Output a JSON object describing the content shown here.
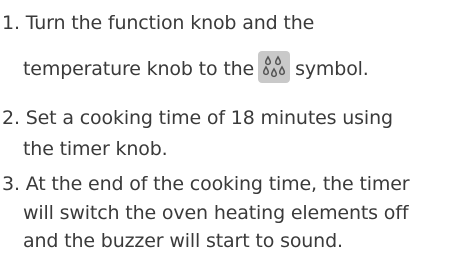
{
  "steps": [
    {
      "number": "1.",
      "line1": "Turn the function knob and the",
      "line2_before": "temperature knob to the",
      "icon": "water-drops-icon",
      "line2_after": "symbol."
    },
    {
      "number": "2.",
      "line1": "Set a cooking time of 18 minutes using",
      "line2": "the timer knob."
    },
    {
      "number": "3.",
      "line1": "At the end of the cooking time, the timer",
      "line2": "will switch the oven heating elements off",
      "line3": "and the buzzer will start to sound."
    }
  ]
}
